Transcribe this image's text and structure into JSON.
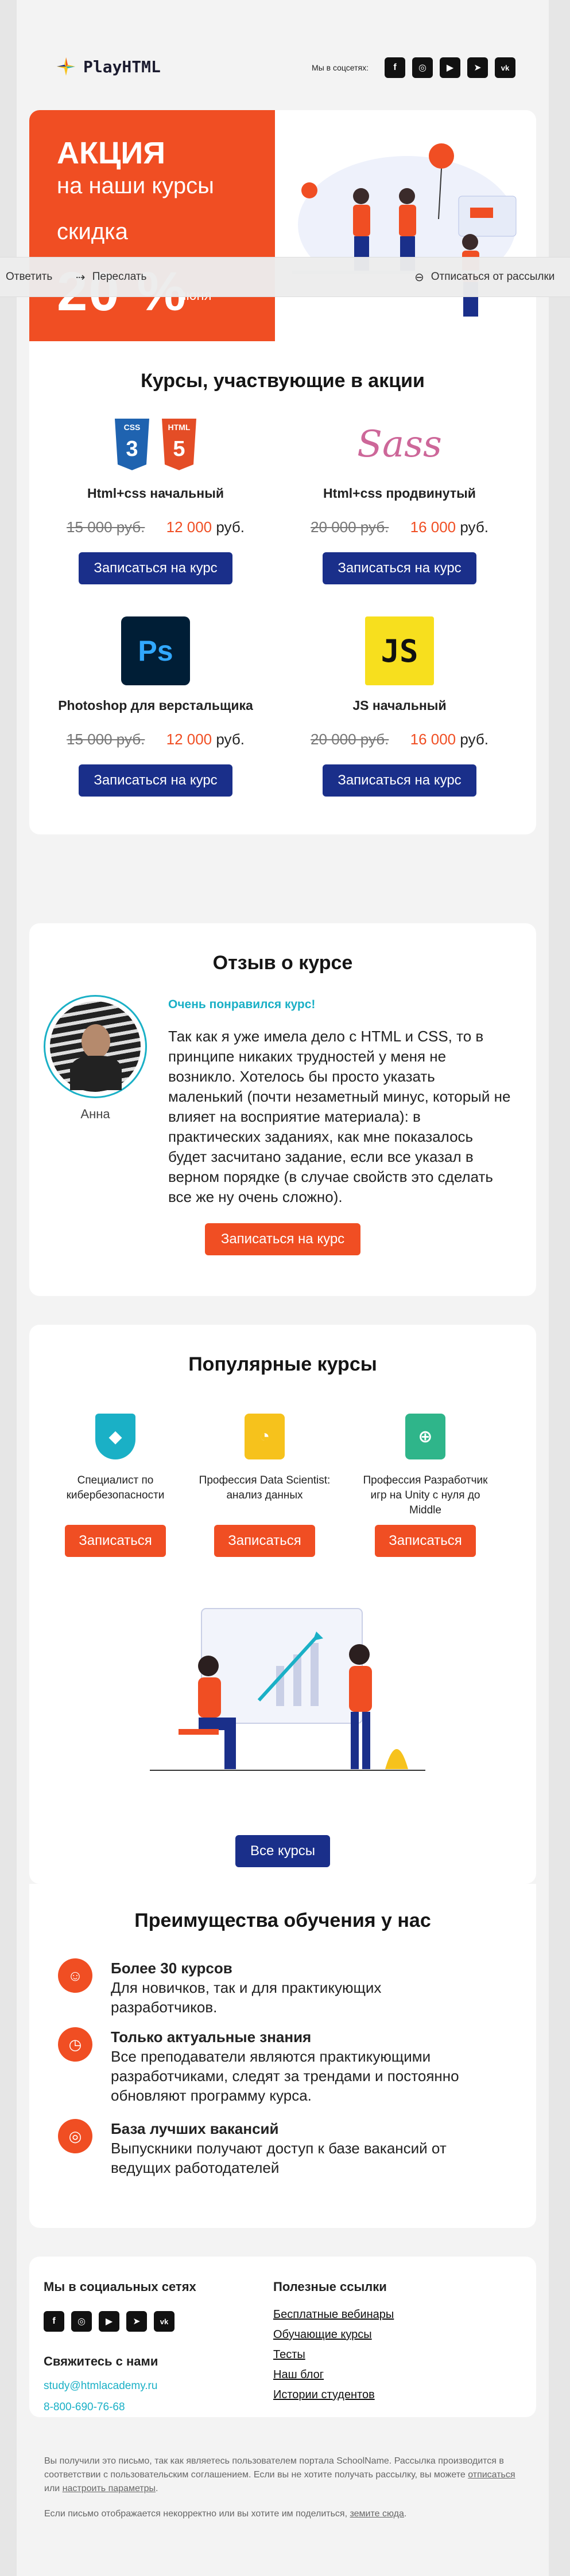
{
  "brand": {
    "name": "PlayHTML",
    "social_label": "Мы в соцсетях:"
  },
  "social_icons": [
    "facebook-icon",
    "instagram-icon",
    "youtube-icon",
    "telegram-icon",
    "vk-icon"
  ],
  "hero": {
    "line1": "АКЦИЯ",
    "line2": "на наши курсы",
    "line3": "скидка",
    "line4": "20 %",
    "line5": "июня"
  },
  "toolbar": {
    "reply": "Ответить",
    "forward": "Переслать",
    "unsubscribe": "Отписаться от рассылки"
  },
  "promo": {
    "title": "Курсы, участвующие в акции",
    "courses": [
      {
        "name": "Html+css начальный",
        "old_price": "15 000 руб.",
        "new_price": "12 000",
        "currency": "руб.",
        "button": "Записаться на курс"
      },
      {
        "name": "Html+css продвинутый",
        "old_price": "20 000 руб.",
        "new_price": "16 000",
        "currency": "руб.",
        "button": "Записаться на курс"
      },
      {
        "name": "Photoshop для верстальщика",
        "old_price": "15 000 руб.",
        "new_price": "12 000",
        "currency": "руб.",
        "button": "Записаться на курс"
      },
      {
        "name": "JS начальный",
        "old_price": "20 000 руб.",
        "new_price": "16 000",
        "currency": "руб.",
        "button": "Записаться на курс"
      }
    ],
    "logos": {
      "css": "CSS",
      "html": "HTML",
      "sass": "Sass",
      "ps": "Ps",
      "js": "JS"
    }
  },
  "review": {
    "title": "Отзыв о курсе",
    "author": "Анна",
    "headline": "Очень понравился курс!",
    "text": "Так как я уже имела дело с HTML и CSS, то в принципе никаких трудностей у меня не возникло. Хотелось бы просто указать маленький (почти незаметный минус, который не влияет на восприятие материала): в практических заданиях, как мне показалось будет засчитано задание, если все указал в верном порядке (в случае свойств это сделать все же ну очень сложно).",
    "button": "Записаться на курс"
  },
  "popular": {
    "title": "Популярные курсы",
    "items": [
      {
        "title": "Специалист по кибербезопасности",
        "button": "Записаться",
        "color": "#1ab0c6",
        "icon": "shield-icon"
      },
      {
        "title": "Профессия Data Scientist: анализ данных",
        "button": "Записаться",
        "color": "#f6c21c",
        "icon": "chart-icon"
      },
      {
        "title": "Профессия Разработчик игр на Unity с нуля до Middle",
        "button": "Записаться",
        "color": "#2fb58a",
        "icon": "gamepad-icon"
      }
    ],
    "all_button": "Все курсы"
  },
  "perks": {
    "title": "Преимущества обучения у нас",
    "items": [
      {
        "title": "Более 30 курсов",
        "text": "Для новичков, так и для практикующих разработчиков.",
        "icon": "smile-icon"
      },
      {
        "title": "Только актуальные знания",
        "text": "Все преподаватели являются практикующими разработчиками, следят за трендами и постоянно обновляют программу курса.",
        "icon": "clock-icon"
      },
      {
        "title": "База лучших вакансий",
        "text": "Выпускники получают доступ к базе вакансий от ведущих работодателей",
        "icon": "target-icon"
      }
    ]
  },
  "footer": {
    "social_title": "Мы в социальных сетях",
    "contact_title": "Свяжитесь с нами",
    "email": "study@htmlacademy.ru",
    "phone": "8-800-690-76-68",
    "links_title": "Полезные ссылки",
    "links": [
      "Бесплатные вебинары",
      "Обучающие курсы",
      "Тесты",
      "Наш блог",
      "Истории студентов"
    ],
    "legal1": "Вы получили это письмо, так как являетесь пользователем портала SchoolName. Рассылка производится в соответствии с пользовательским соглашением. Если вы не хотите получать рассылку, вы можете",
    "legal1_link1": "отписаться",
    "legal1_mid": "или",
    "legal1_link2": "настроить параметры",
    "legal2": "Если письмо отображается некорректно или вы хотите им поделиться,",
    "legal2_link": "земите сюда"
  },
  "colors": {
    "accent": "#f04e23",
    "brand_blue": "#1a2f8a",
    "teal": "#1ab0c6"
  }
}
